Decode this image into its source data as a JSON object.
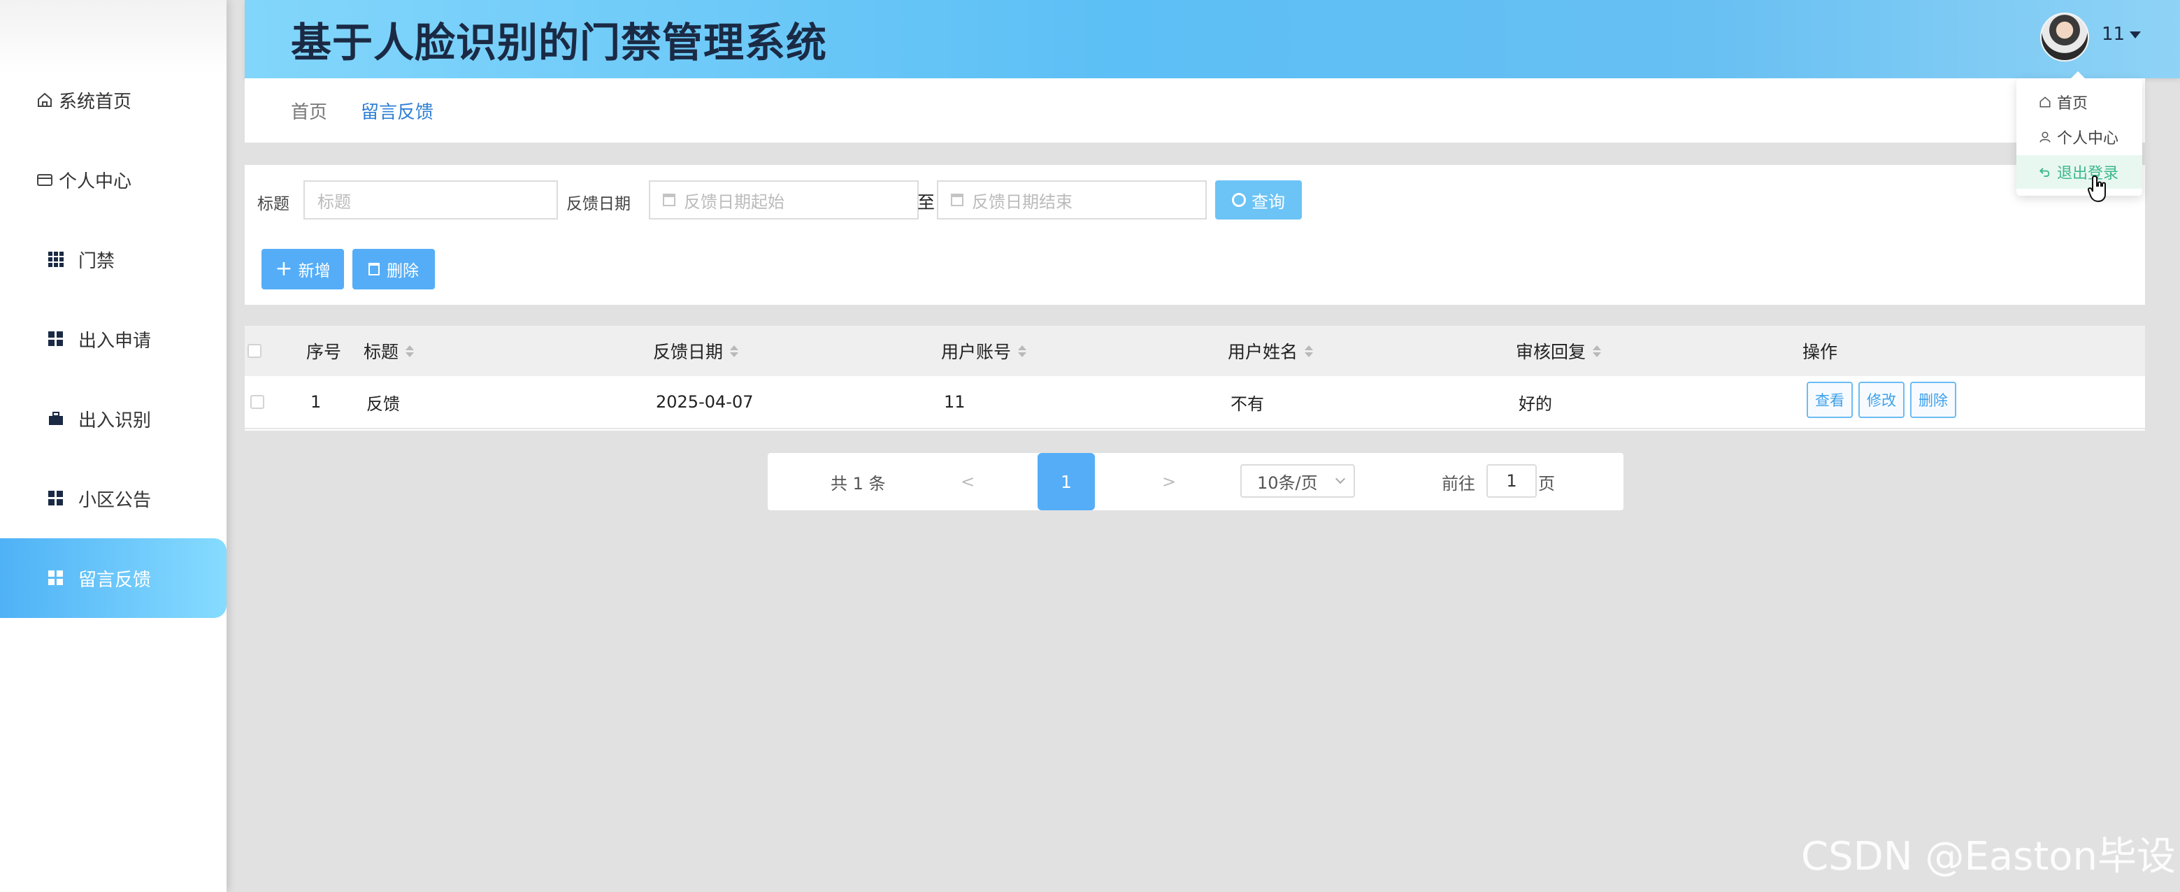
{
  "app": {
    "title": "基于人脸识别的门禁管理系统",
    "user_name": "11"
  },
  "sidebar": {
    "items": [
      {
        "label": "系统首页",
        "icon": "home-icon"
      },
      {
        "label": "个人中心",
        "icon": "card-icon"
      },
      {
        "label": "门禁",
        "icon": "grid-icon"
      },
      {
        "label": "出入申请",
        "icon": "grid-icon"
      },
      {
        "label": "出入识别",
        "icon": "briefcase-icon"
      },
      {
        "label": "小区公告",
        "icon": "grid-icon"
      },
      {
        "label": "留言反馈",
        "icon": "grid-icon",
        "active": true
      }
    ]
  },
  "breadcrumb": {
    "home": "首页",
    "current": "留言反馈"
  },
  "search": {
    "title_label": "标题",
    "title_placeholder": "标题",
    "date_label": "反馈日期",
    "date_start_placeholder": "反馈日期起始",
    "date_to": "至",
    "date_end_placeholder": "反馈日期结束",
    "query_button": "查询"
  },
  "actions": {
    "add_button": "新增",
    "delete_button": "删除"
  },
  "table": {
    "columns": [
      "序号",
      "标题",
      "反馈日期",
      "用户账号",
      "用户姓名",
      "审核回复",
      "操作"
    ],
    "rows": [
      {
        "index": "1",
        "title": "反馈",
        "date": "2025-04-07",
        "account": "11",
        "name": "不有",
        "reply": "好的",
        "ops": [
          "查看",
          "修改",
          "删除"
        ]
      }
    ]
  },
  "pagination": {
    "total": "共 1 条",
    "prev": "<",
    "current_page": "1",
    "next": ">",
    "page_size": "10条/页",
    "goto_prefix": "前往",
    "goto_value": "1",
    "goto_suffix": "页"
  },
  "user_menu": {
    "items": [
      {
        "label": "首页",
        "icon": "home-icon"
      },
      {
        "label": "个人中心",
        "icon": "user-icon"
      },
      {
        "label": "退出登录",
        "icon": "logout-icon",
        "hover": true
      }
    ]
  },
  "watermark": "CSDN @Easton毕设",
  "colors": {
    "accent": "#55adf7",
    "header_gradient_start": "#82d6fb",
    "active_menu": "#4fb2f6",
    "logout_hover": "#3cb88a",
    "title_text": "#1b2a44"
  }
}
